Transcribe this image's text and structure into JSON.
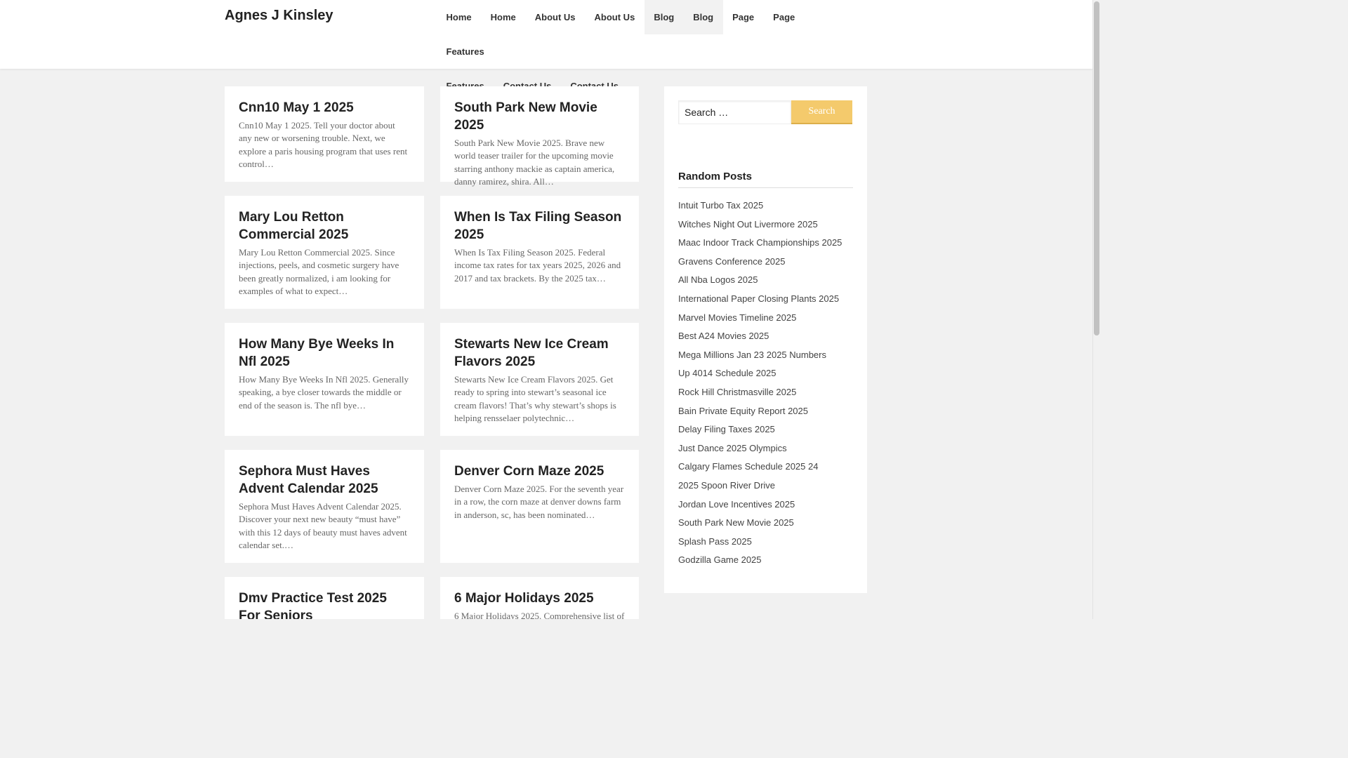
{
  "site": {
    "title": "Agnes J Kinsley"
  },
  "nav": {
    "row1": [
      "Home",
      "Home",
      "About Us",
      "About Us",
      "Blog",
      "Blog",
      "Page",
      "Page",
      "Features"
    ],
    "row2": [
      "Features",
      "Contact Us",
      "Contact Us"
    ]
  },
  "posts": [
    {
      "title": "Cnn10 May 1 2025",
      "excerpt": "Cnn10 May 1 2025. Tell your doctor about any new or worsening trouble. Next, we explore a paris housing program that uses rent control…"
    },
    {
      "title": "South Park New Movie 2025",
      "excerpt": "South Park New Movie 2025. Brave new world teaser trailer for the upcoming movie starring anthony mackie as captain america, danny ramirez, shira. All…"
    },
    {
      "title": "Mary Lou Retton Commercial 2025",
      "excerpt": "Mary Lou Retton Commercial 2025. Since injections, peels, and cosmetic surgery have been greatly normalized, i am looking for examples of what to expect…"
    },
    {
      "title": "When Is Tax Filing Season 2025",
      "excerpt": "When Is Tax Filing Season 2025. Federal income tax rates for tax years 2025, 2026 and 2017 and tax brackets. By the 2025 tax…"
    },
    {
      "title": "How Many Bye Weeks In Nfl 2025",
      "excerpt": "How Many Bye Weeks In Nfl 2025. Generally speaking, a bye closer towards the middle or end of the season is. The nfl bye…"
    },
    {
      "title": "Stewarts New Ice Cream Flavors 2025",
      "excerpt": "Stewarts New Ice Cream Flavors 2025. Get ready to spring into stewart’s seasonal ice cream flavors! That’s why stewart’s shops is helping rensselaer polytechnic…"
    },
    {
      "title": "Sephora Must Haves Advent Calendar 2025",
      "excerpt": "Sephora Must Haves Advent Calendar 2025. Discover your next new beauty “must have” with this 12 days of beauty must haves advent calendar set.…"
    },
    {
      "title": "Denver Corn Maze 2025",
      "excerpt": "Denver Corn Maze 2025. For the seventh year in a row, the corn maze at denver downs farm in anderson, sc, has been nominated…"
    },
    {
      "title": "Dmv Practice Test 2025 For Seniors",
      "excerpt": ""
    },
    {
      "title": "6 Major Holidays 2025",
      "excerpt": "6 Major Holidays 2025. Comprehensive list of"
    }
  ],
  "sidebar": {
    "search_placeholder": "Search …",
    "search_button": "Search",
    "random_title": "Random Posts",
    "random_posts": [
      "Intuit Turbo Tax 2025",
      "Witches Night Out Livermore 2025",
      "Maac Indoor Track Championships 2025",
      "Gravens Conference 2025",
      "All Nba Logos 2025",
      "International Paper Closing Plants 2025",
      "Marvel Movies Timeline 2025",
      "Best A24 Movies 2025",
      "Mega Millions Jan 23 2025 Numbers",
      "Up 4014 Schedule 2025",
      "Rock Hill Christmasville 2025",
      "Bain Private Equity Report 2025",
      "Delay Filing Taxes 2025",
      "Just Dance 2025 Olympics",
      "Calgary Flames Schedule 2025 24",
      "2025 Spoon River Drive",
      "Jordan Love Incentives 2025",
      "South Park New Movie 2025",
      "Splash Pass 2025",
      "Godzilla Game 2025"
    ]
  }
}
